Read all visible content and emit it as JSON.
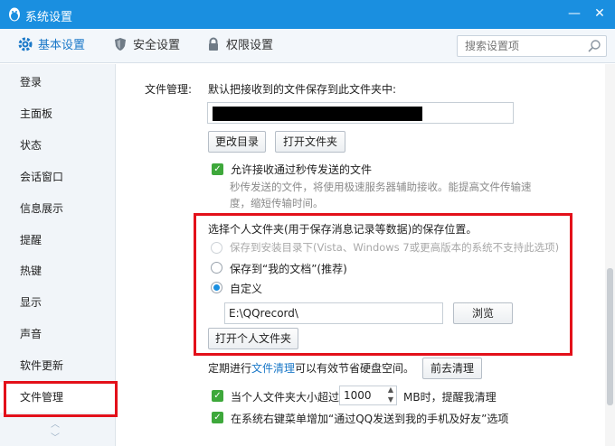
{
  "window": {
    "title": "系统设置"
  },
  "tabs": [
    {
      "label": "基本设置",
      "icon": "gear-icon"
    },
    {
      "label": "安全设置",
      "icon": "shield-icon"
    },
    {
      "label": "权限设置",
      "icon": "lock-icon"
    }
  ],
  "search": {
    "placeholder": "搜索设置项"
  },
  "sidebar": {
    "items": [
      "登录",
      "主面板",
      "状态",
      "会话窗口",
      "信息展示",
      "提醒",
      "热键",
      "显示",
      "声音",
      "软件更新",
      "文件管理"
    ]
  },
  "file_mgmt": {
    "section_label": "文件管理:",
    "default_save_text": "默认把接收到的文件保存到此文件夹中:",
    "change_dir_label": "更改目录",
    "open_folder_label": "打开文件夹",
    "allow_flash_label": "允许接收通过秒传发送的文件",
    "flash_desc_line1": "秒传发送的文件，将使用极速服务器辅助接收。能提高文件传输速",
    "flash_desc_line2": "度，缩短传输时间。"
  },
  "personal_folder": {
    "heading": "选择个人文件夹(用于保存消息记录等数据)的保存位置。",
    "option_install": "保存到安装目录下(Vista、Windows 7或更高版本的系统不支持此选项)",
    "option_mydocs": "保存到“我的文档”(推荐)",
    "option_custom": "自定义",
    "custom_path": "E:\\QQrecord\\",
    "browse_label": "浏览",
    "open_personal_label": "打开个人文件夹"
  },
  "cleanup": {
    "text_prefix": "定期进行",
    "link": "文件清理",
    "text_suffix": "可以有效节省硬盘空间。",
    "button_label": "前去清理"
  },
  "size_limit": {
    "label_prefix": "当个人文件夹大小超过",
    "value": "1000",
    "label_suffix": "MB时，提醒我清理"
  },
  "context_menu": {
    "label": "在系统右键菜单增加“通过QQ发送到我的手机及好友”选项"
  },
  "colors": {
    "accent": "#1a8fe0",
    "highlight": "#e3101a",
    "check": "#3ea83b"
  }
}
